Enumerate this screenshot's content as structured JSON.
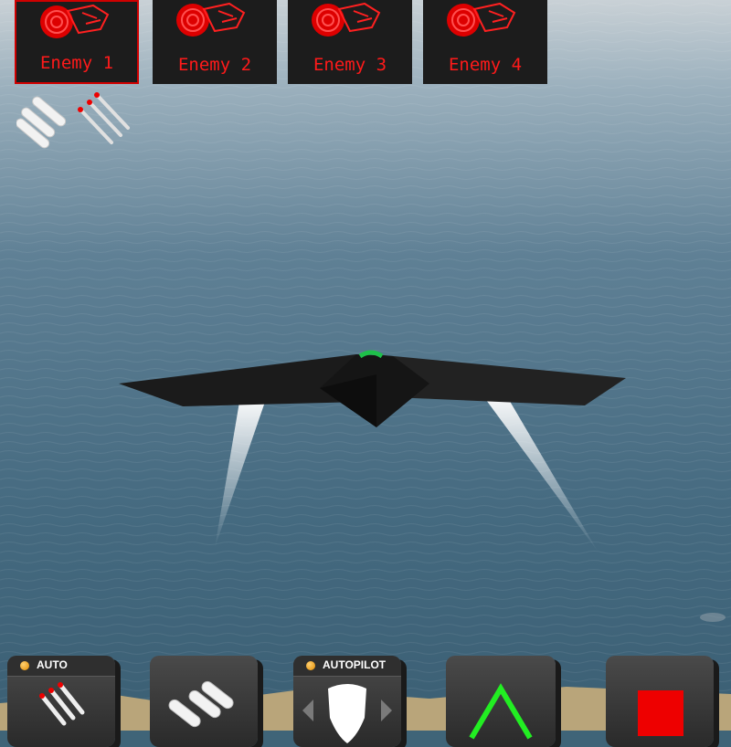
{
  "enemies": [
    {
      "label": "Enemy 1",
      "selected": true
    },
    {
      "label": "Enemy 2",
      "selected": false
    },
    {
      "label": "Enemy 3",
      "selected": false
    },
    {
      "label": "Enemy 4",
      "selected": false
    }
  ],
  "controls": {
    "auto_label": "AUTO",
    "autopilot_label": "AUTOPILOT"
  },
  "colors": {
    "enemy_text": "#ff1a1a",
    "selected_border": "#d00000",
    "indicator_led": "#f0a020",
    "climb_arrow": "#22ee22",
    "stop_square": "#ee0000"
  },
  "icons": {
    "enemy": "enemy-radar-icon",
    "missiles": "missile-ammo-icon",
    "shield": "shield-icon",
    "climb": "up-arrow-icon",
    "stop": "stop-icon"
  }
}
